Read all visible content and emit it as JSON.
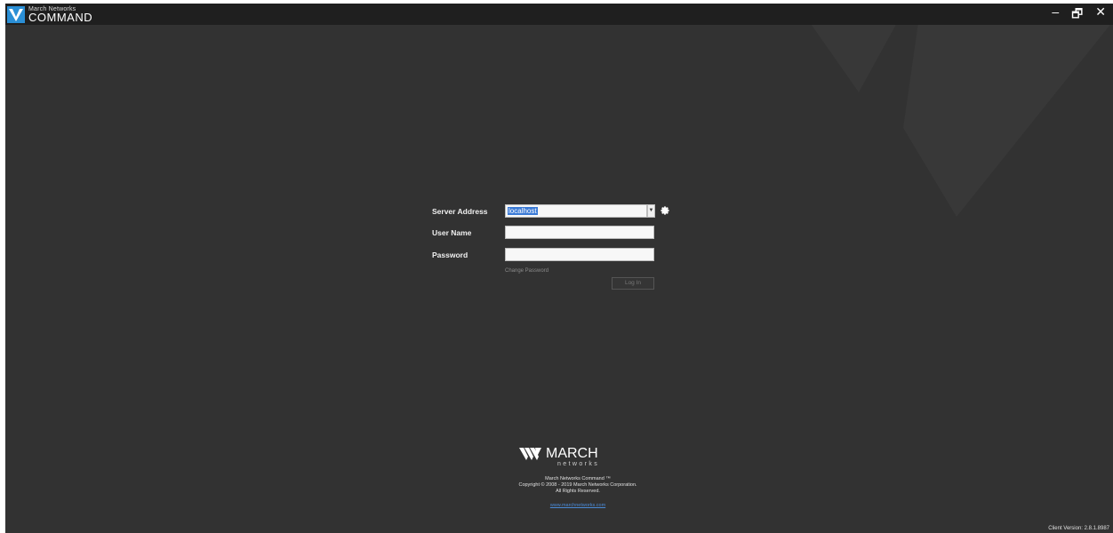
{
  "window": {
    "brand_line": "March Networks",
    "product_name": "COMMAND",
    "controls": {
      "minimize": "–",
      "restore": "🗗",
      "close": "✕"
    }
  },
  "login": {
    "server_address_label": "Server Address",
    "server_address_value": "localhost",
    "user_name_label": "User Name",
    "user_name_value": "",
    "password_label": "Password",
    "password_value": "",
    "change_password_link": "Change Password",
    "login_button": "Log In"
  },
  "footer": {
    "logo_text": "MARCH",
    "logo_subtext": "networks",
    "product_line": "March Networks Command ™",
    "copyright": "Copyright © 2008 - 2019 March Networks Corporation.",
    "rights": "All Rights Reserved.",
    "website": "www.marchnetworks.com"
  },
  "client_version": "Client Version: 2.8.1.8987",
  "colors": {
    "background": "#323232",
    "titlebar": "#1f1f1f",
    "accent": "#1e7fc7",
    "selection": "#3a7ad6",
    "link": "#4a8ad6"
  },
  "icons": {
    "logo": "march-networks-logo-icon",
    "settings": "gear-icon",
    "dropdown": "chevron-down-icon"
  }
}
